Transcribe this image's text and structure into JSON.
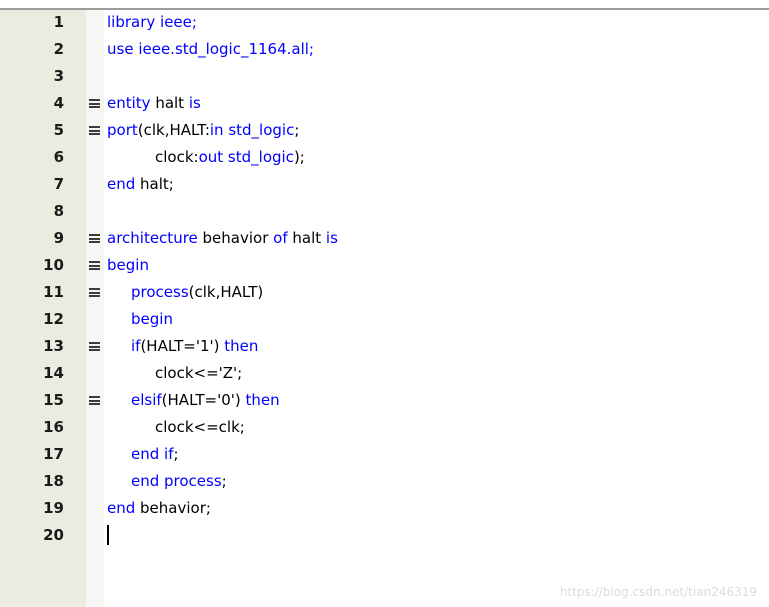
{
  "colors": {
    "keyword": "#0000ff",
    "text": "#000000",
    "gutter": "#ebebdf"
  },
  "fold_icon": "fold-box-icon",
  "lines": [
    {
      "n": "1",
      "fold": false,
      "indent": 0,
      "tokens": [
        [
          "kw",
          "library ieee;"
        ]
      ]
    },
    {
      "n": "2",
      "fold": false,
      "indent": 0,
      "tokens": [
        [
          "kw",
          "use ieee.std_logic_1164.all;"
        ]
      ]
    },
    {
      "n": "3",
      "fold": false,
      "indent": 0,
      "tokens": []
    },
    {
      "n": "4",
      "fold": true,
      "indent": 0,
      "tokens": [
        [
          "kw",
          "entity"
        ],
        [
          "tx",
          " halt "
        ],
        [
          "kw",
          "is"
        ]
      ]
    },
    {
      "n": "5",
      "fold": true,
      "indent": 0,
      "tokens": [
        [
          "kw",
          "port"
        ],
        [
          "tx",
          "(clk,HALT:"
        ],
        [
          "kw",
          "in std_logic"
        ],
        [
          "tx",
          ";"
        ]
      ]
    },
    {
      "n": "6",
      "fold": false,
      "indent": 2,
      "tokens": [
        [
          "tx",
          "clock:"
        ],
        [
          "kw",
          "out std_logic"
        ],
        [
          "tx",
          ");"
        ]
      ]
    },
    {
      "n": "7",
      "fold": false,
      "indent": 0,
      "tokens": [
        [
          "kw",
          "end"
        ],
        [
          "tx",
          " halt;"
        ]
      ]
    },
    {
      "n": "8",
      "fold": false,
      "indent": 0,
      "tokens": []
    },
    {
      "n": "9",
      "fold": true,
      "indent": 0,
      "tokens": [
        [
          "kw",
          "architecture"
        ],
        [
          "tx",
          " behavior "
        ],
        [
          "kw",
          "of"
        ],
        [
          "tx",
          " halt "
        ],
        [
          "kw",
          "is"
        ]
      ]
    },
    {
      "n": "10",
      "fold": true,
      "indent": 0,
      "tokens": [
        [
          "kw",
          "begin"
        ]
      ]
    },
    {
      "n": "11",
      "fold": true,
      "indent": 1,
      "tokens": [
        [
          "kw",
          "process"
        ],
        [
          "tx",
          "(clk,HALT)"
        ]
      ]
    },
    {
      "n": "12",
      "fold": false,
      "indent": 1,
      "tokens": [
        [
          "kw",
          "begin"
        ]
      ]
    },
    {
      "n": "13",
      "fold": true,
      "indent": 1,
      "tokens": [
        [
          "kw",
          "if"
        ],
        [
          "tx",
          "(HALT='1') "
        ],
        [
          "kw",
          "then"
        ]
      ]
    },
    {
      "n": "14",
      "fold": false,
      "indent": 2,
      "tokens": [
        [
          "tx",
          "clock<='Z';"
        ]
      ]
    },
    {
      "n": "15",
      "fold": true,
      "indent": 1,
      "tokens": [
        [
          "kw",
          "elsif"
        ],
        [
          "tx",
          "(HALT='0') "
        ],
        [
          "kw",
          "then"
        ]
      ]
    },
    {
      "n": "16",
      "fold": false,
      "indent": 2,
      "tokens": [
        [
          "tx",
          "clock<=clk;"
        ]
      ]
    },
    {
      "n": "17",
      "fold": false,
      "indent": 1,
      "tokens": [
        [
          "kw",
          "end if"
        ],
        [
          "tx",
          ";"
        ]
      ]
    },
    {
      "n": "18",
      "fold": false,
      "indent": 1,
      "tokens": [
        [
          "kw",
          "end process"
        ],
        [
          "tx",
          ";"
        ]
      ]
    },
    {
      "n": "19",
      "fold": false,
      "indent": 0,
      "tokens": [
        [
          "kw",
          "end"
        ],
        [
          "tx",
          " behavior;"
        ]
      ]
    },
    {
      "n": "20",
      "fold": false,
      "indent": 0,
      "tokens": []
    }
  ],
  "watermark": "https://blog.csdn.net/tian246319"
}
